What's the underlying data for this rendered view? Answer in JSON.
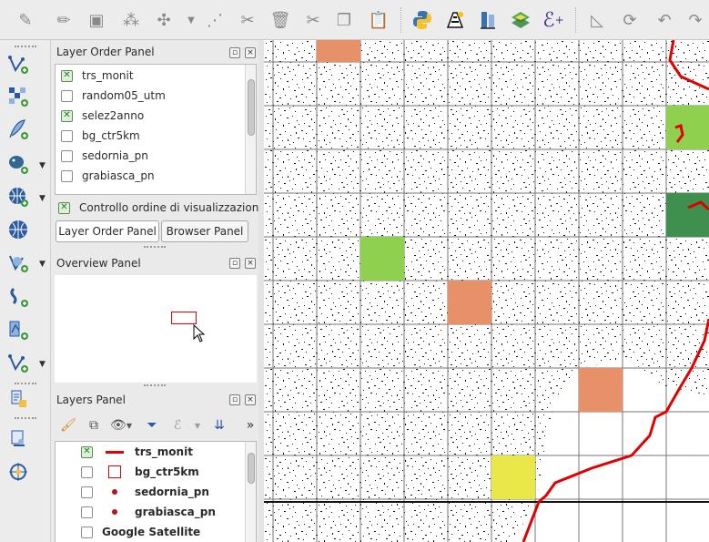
{
  "toolbar": {
    "icons": [
      "digitize-icon",
      "edit-pencil-icon",
      "save-edits-icon",
      "add-point-icon",
      "move-feature-icon",
      "dropdown-icon",
      "node-tool-icon",
      "delete-feature-icon",
      "cut-icon",
      "copy-icon",
      "paste-icon",
      "python-icon",
      "gps-icon",
      "measure-icon",
      "layers-3d-icon",
      "expression-icon",
      "ruler-icon",
      "undo-icon",
      "redo-icon"
    ]
  },
  "left_toolbar": {
    "icons": [
      "add-vector-layer-icon",
      "add-raster-layer-icon",
      "add-delimited-text-icon",
      "add-postgis-icon",
      "add-wms-icon",
      "add-wcs-icon",
      "add-wfs-icon",
      "add-spatialite-icon",
      "add-virtual-layer-icon",
      "new-shapefile-icon",
      "new-layer-icon",
      "georeference-icon",
      "gps-tool-icon"
    ]
  },
  "layer_order_panel": {
    "title": "Layer Order Panel",
    "items": [
      {
        "label": "trs_monit",
        "checked": true
      },
      {
        "label": "random05_utm",
        "checked": false
      },
      {
        "label": "selez2anno",
        "checked": true
      },
      {
        "label": "bg_ctr5km",
        "checked": false
      },
      {
        "label": "sedornia_pn",
        "checked": false
      },
      {
        "label": "grabiasca_pn",
        "checked": false
      }
    ],
    "control_label": "Controllo ordine di visualizzazione",
    "tabs": [
      "Layer Order Panel",
      "Browser Panel"
    ]
  },
  "overview_panel": {
    "title": "Overview Panel"
  },
  "layers_panel": {
    "title": "Layers Panel",
    "items": [
      {
        "label": "trs_monit",
        "checked": true,
        "symbol": "line"
      },
      {
        "label": "bg_ctr5km",
        "checked": false,
        "symbol": "box"
      },
      {
        "label": "sedornia_pn",
        "checked": false,
        "symbol": "dot"
      },
      {
        "label": "grabiasca_pn",
        "checked": false,
        "symbol": "dot"
      },
      {
        "label": "Google Satellite",
        "checked": false,
        "symbol": "none"
      }
    ]
  },
  "colors": {
    "accent_red": "#e00000",
    "cell_orange": "#e8906a",
    "cell_green": "#8fd14f",
    "cell_darkgreen": "#3f8f4f",
    "cell_yellow": "#e8e84a"
  }
}
